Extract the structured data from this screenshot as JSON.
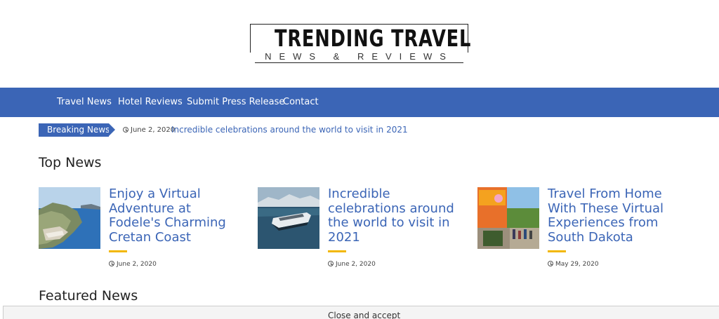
{
  "logo": {
    "title": "TRENDING TRAVEL",
    "subtitle": "NEWS & REVIEWS"
  },
  "nav": {
    "items": [
      {
        "label": "Travel News"
      },
      {
        "label": "Hotel Reviews"
      },
      {
        "label": "Submit Press Release"
      },
      {
        "label": "Contact"
      }
    ]
  },
  "breaking": {
    "label": "Breaking News",
    "date": "June 2, 2020",
    "headline": "Incredible celebrations around the world to visit in 2021"
  },
  "top_news": {
    "title": "Top News",
    "articles": [
      {
        "title": "Enjoy a Virtual Adventure at Fodele's Charming Cretan Coast",
        "date": "June 2, 2020",
        "image": "coastal-resort-photo"
      },
      {
        "title": "Incredible celebrations around the world to visit in 2021",
        "date": "June 2, 2020",
        "image": "cruise-ship-photo"
      },
      {
        "title": "Travel From Home With These Virtual Experiences from South Dakota",
        "date": "May 29, 2020",
        "image": "festival-crowd-photo"
      }
    ]
  },
  "featured_news": {
    "title": "Featured News"
  },
  "cookie": {
    "button_label": "Close and accept"
  },
  "colors": {
    "brand_blue": "#3b65b6",
    "accent_yellow": "#f2b705"
  }
}
